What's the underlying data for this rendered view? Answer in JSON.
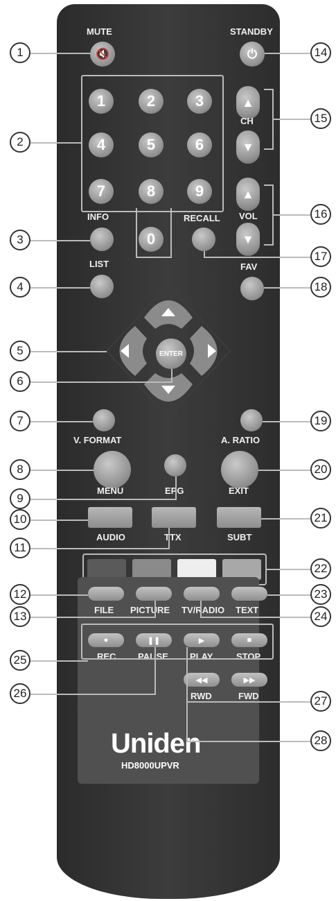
{
  "remote": {
    "brand": "Uniden",
    "model": "HD8000UPVR"
  },
  "labels": {
    "mute": "MUTE",
    "standby": "STANDBY",
    "ch": "CH",
    "vol": "VOL",
    "info": "INFO",
    "recall": "RECALL",
    "list": "LIST",
    "fav": "FAV",
    "enter": "ENTER",
    "v_format": "V. FORMAT",
    "a_ratio": "A. RATIO",
    "menu": "MENU",
    "epg": "EPG",
    "exit": "EXIT",
    "audio": "AUDIO",
    "ttx": "TTX",
    "subt": "SUBT",
    "file": "FILE",
    "picture": "PICTURE",
    "tv_radio": "TV/RADIO",
    "text": "TEXT",
    "rec": "REC",
    "pause": "PAUSE",
    "play": "PLAY",
    "stop": "STOP",
    "rwd": "RWD",
    "fwd": "FWD"
  },
  "digits": [
    "1",
    "2",
    "3",
    "4",
    "5",
    "6",
    "7",
    "8",
    "9",
    "0"
  ],
  "callouts": [
    "1",
    "2",
    "3",
    "4",
    "5",
    "6",
    "7",
    "8",
    "9",
    "10",
    "11",
    "12",
    "13",
    "14",
    "15",
    "16",
    "17",
    "18",
    "19",
    "20",
    "21",
    "22",
    "23",
    "24",
    "25",
    "26",
    "27",
    "28"
  ],
  "colors": {
    "body": "#333333",
    "color_keys": [
      "#5a5a5a",
      "#8a8a8a",
      "#eeeeee",
      "#a8a8a8"
    ]
  },
  "icons": {
    "mute": "mute-icon",
    "standby": "power-icon",
    "up": "arrow-up-icon",
    "down": "arrow-down-icon",
    "left": "arrow-left-icon",
    "right": "arrow-right-icon",
    "play": "play-icon",
    "pause": "pause-icon",
    "stop": "stop-icon",
    "rec": "record-icon",
    "rwd": "rewind-icon",
    "fwd": "fast-forward-icon"
  }
}
